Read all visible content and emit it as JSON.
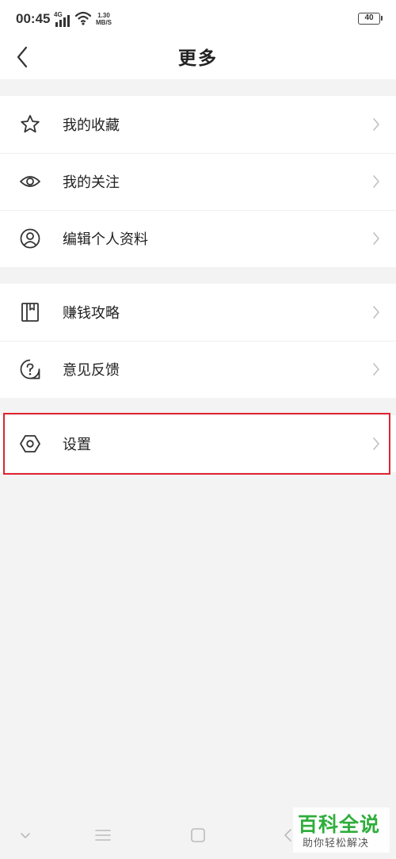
{
  "status_bar": {
    "time": "00:45",
    "network_type": "4G",
    "net_speed_value": "1.30",
    "net_speed_unit": "MB/S",
    "battery": "40"
  },
  "header": {
    "title": "更多"
  },
  "menu_groups": [
    [
      {
        "label": "我的收藏",
        "icon": "star-icon"
      },
      {
        "label": "我的关注",
        "icon": "eye-icon"
      },
      {
        "label": "编辑个人资料",
        "icon": "user-icon"
      }
    ],
    [
      {
        "label": "赚钱攻略",
        "icon": "book-icon"
      },
      {
        "label": "意见反馈",
        "icon": "feedback-icon"
      }
    ],
    [
      {
        "label": "设置",
        "icon": "settings-icon"
      }
    ]
  ],
  "highlight_color": "#e0242f",
  "watermark": {
    "title": "百科全说",
    "subtitle": "助你轻松解决",
    "color": "#2fae3c"
  },
  "nav_bar": {
    "buttons": [
      "hide-keyboard-icon",
      "menu-icon",
      "home-icon",
      "back-icon"
    ]
  }
}
